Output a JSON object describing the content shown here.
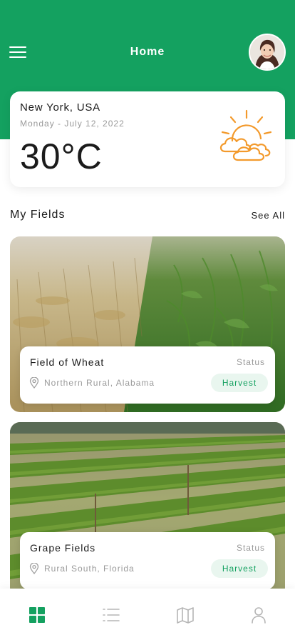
{
  "header": {
    "title": "Home",
    "menu_icon": "hamburger-menu-icon",
    "avatar_icon": "user-avatar"
  },
  "weather": {
    "city": "New York, USA",
    "date": "Monday - July 12, 2022",
    "temperature": "30°C",
    "icon": "sun-cloud-icon"
  },
  "fields_section": {
    "title": "My Fields",
    "see_all_label": "See All",
    "items": [
      {
        "name": "Field of Wheat",
        "status_label": "Status",
        "location": "Northern Rural, Alabama",
        "status": "Harvest"
      },
      {
        "name": "Grape Fields",
        "status_label": "Status",
        "location": "Rural South, Florida",
        "status": "Harvest"
      }
    ]
  },
  "tabbar": {
    "items": [
      {
        "icon": "dashboard-grid-icon",
        "active": true
      },
      {
        "icon": "list-icon",
        "active": false
      },
      {
        "icon": "map-icon",
        "active": false
      },
      {
        "icon": "profile-icon",
        "active": false
      }
    ]
  },
  "colors": {
    "accent": "#14a160",
    "sun_icon": "#f39a2c",
    "muted_text": "#9a9a9a",
    "status_pill_bg": "#e9f6ef"
  }
}
